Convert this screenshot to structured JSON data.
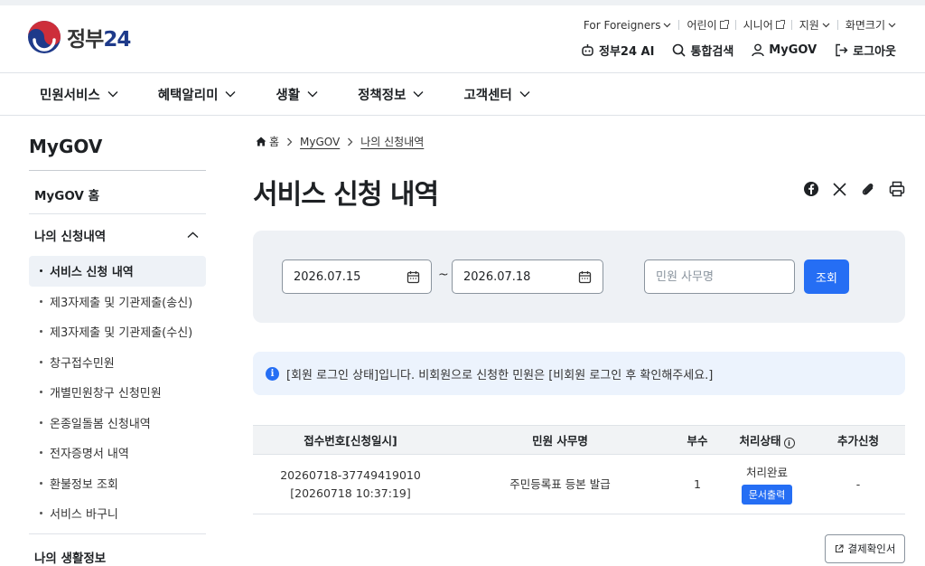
{
  "header": {
    "logo_text": "정부",
    "logo_num": "24",
    "util": [
      "For Foreigners",
      "어린이",
      "시니어",
      "지원",
      "화면크기"
    ],
    "ai": "정부24 AI",
    "search": "통합검색",
    "mygov": "MyGOV",
    "logout": "로그아웃"
  },
  "nav": [
    "민원서비스",
    "혜택알리미",
    "생활",
    "정책정보",
    "고객센터"
  ],
  "sidebar": {
    "title": "MyGOV",
    "home": "MyGOV 홈",
    "section": "나의 신청내역",
    "items": [
      "서비스 신청 내역",
      "제3자제출 및 기관제출(송신)",
      "제3자제출 및 기관제출(수신)",
      "창구접수민원",
      "개별민원창구 신청민원",
      "온종일돌봄 신청내역",
      "전자증명서 내역",
      "환불정보 조회",
      "서비스 바구니"
    ],
    "next_section": "나의 생활정보"
  },
  "breadcrumb": {
    "home": "홈",
    "c1": "MyGOV",
    "c2": "나의 신청내역"
  },
  "page_title": "서비스 신청 내역",
  "filter": {
    "start_date": "2026.07.15",
    "tilde": "~",
    "end_date": "2026.07.18",
    "placeholder": "민원 사무명",
    "search_btn": "조회"
  },
  "notice": "[회원 로그인 상태]입니다. 비회원으로 신청한 민원은 [비회원 로그인 후 확인해주세요.]",
  "table": {
    "headers": [
      "접수번호[신청일시]",
      "민원 사무명",
      "부수",
      "처리상태",
      "추가신청"
    ],
    "row": {
      "receipt_no": "20260718-37749419010",
      "receipt_time": "[20260718 10:37:19]",
      "service": "주민등록표 등본 발급",
      "copies": "1",
      "status": "처리완료",
      "print_btn": "문서출력",
      "extra": "-"
    }
  },
  "pay_btn": "결제확인서"
}
